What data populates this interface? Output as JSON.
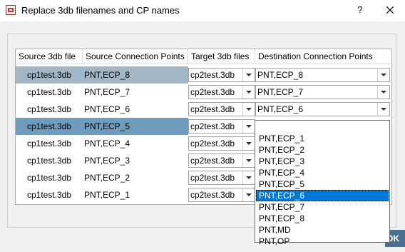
{
  "window": {
    "title": "Replace 3db filenames and CP names",
    "help_label": "?",
    "close_icon": "close-icon"
  },
  "table": {
    "headers": [
      "Source 3db file",
      "Source Connection Points",
      "Target 3db files",
      "Destination Connection Points"
    ],
    "rows": [
      {
        "source_file": "cp1test.3db",
        "source_cp": "PNT,ECP_8",
        "target_file": "cp2test.3db",
        "dest_cp": "PNT,ECP_8",
        "state": "selected-inactive"
      },
      {
        "source_file": "cp1test.3db",
        "source_cp": "PNT,ECP_7",
        "target_file": "cp2test.3db",
        "dest_cp": "PNT,ECP_7",
        "state": "normal"
      },
      {
        "source_file": "cp1test.3db",
        "source_cp": "PNT,ECP_6",
        "target_file": "cp2test.3db",
        "dest_cp": "PNT,ECP_6",
        "state": "normal"
      },
      {
        "source_file": "cp1test.3db",
        "source_cp": "PNT,ECP_5",
        "target_file": "cp2test.3db",
        "dest_cp": "",
        "state": "selected"
      },
      {
        "source_file": "cp1test.3db",
        "source_cp": "PNT,ECP_4",
        "target_file": "cp2test.3db",
        "dest_cp": "",
        "state": "normal"
      },
      {
        "source_file": "cp1test.3db",
        "source_cp": "PNT,ECP_3",
        "target_file": "cp2test.3db",
        "dest_cp": "",
        "state": "normal"
      },
      {
        "source_file": "cp1test.3db",
        "source_cp": "PNT,ECP_2",
        "target_file": "cp2test.3db",
        "dest_cp": "",
        "state": "normal"
      },
      {
        "source_file": "cp1test.3db",
        "source_cp": "PNT,ECP_1",
        "target_file": "cp2test.3db",
        "dest_cp": "",
        "state": "normal"
      }
    ]
  },
  "dropdown": {
    "options": [
      "",
      "PNT,ECP_1",
      "PNT,ECP_2",
      "PNT,ECP_3",
      "PNT,ECP_4",
      "PNT,ECP_5",
      "PNT,ECP_6",
      "PNT,ECP_7",
      "PNT,ECP_8",
      "PNT,MD",
      "PNT,OP"
    ],
    "highlighted": "PNT,ECP_6"
  },
  "buttons": {
    "ok_label": "OK"
  },
  "colors": {
    "selected_inactive": "#a3b6c6",
    "selected": "#6f9bbd",
    "highlight": "#0078d7"
  }
}
